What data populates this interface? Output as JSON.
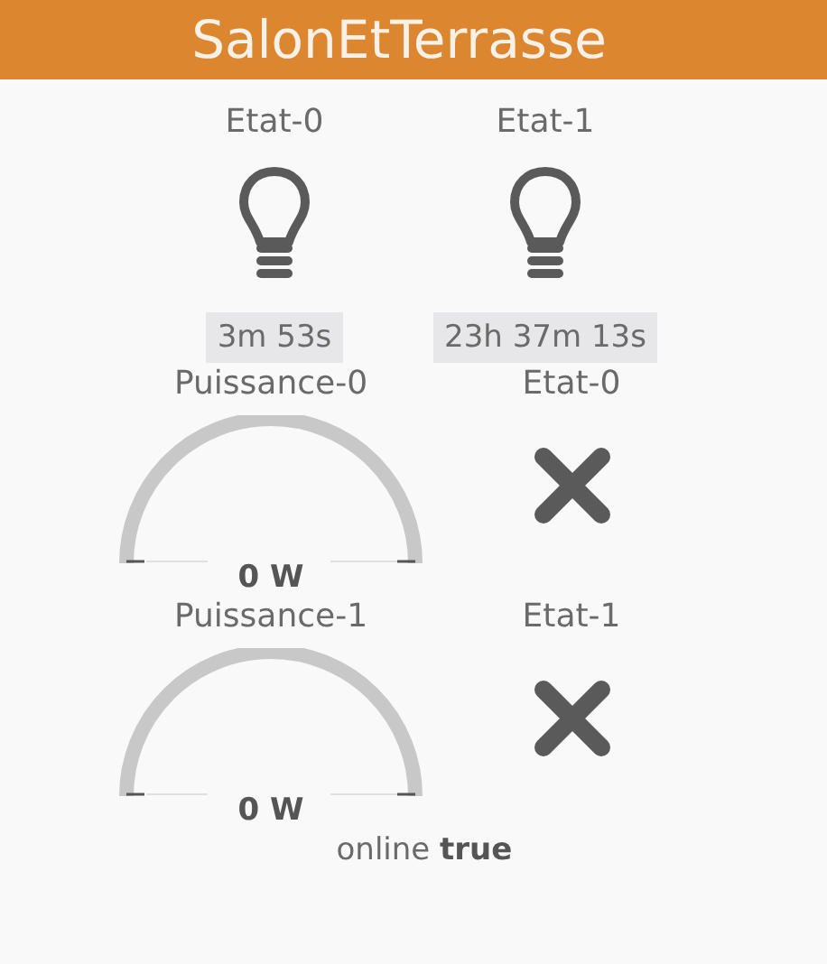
{
  "header": {
    "title": "SalonEtTerrasse"
  },
  "lights": [
    {
      "label": "Etat-0",
      "on": false,
      "duration": "3m 53s"
    },
    {
      "label": "Etat-1",
      "on": false,
      "duration": "23h 37m 13s"
    }
  ],
  "channels": [
    {
      "power_label": "Puissance-0",
      "reading": "0 W",
      "state_label": "Etat-0",
      "on": false
    },
    {
      "power_label": "Puissance-1",
      "reading": "0 W",
      "state_label": "Etat-1",
      "on": false
    }
  ],
  "status_line": "online **true**"
}
